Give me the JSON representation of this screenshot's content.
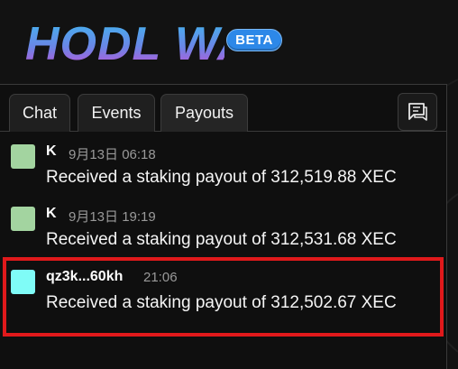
{
  "app": {
    "title": "HODL WARS",
    "badge": "BETA",
    "colors": {
      "accent": "#2d88e8",
      "logo_top": "#3fb8f0",
      "logo_bottom": "#c64fd6",
      "highlight": "#e0191b"
    }
  },
  "tabs": [
    {
      "label": "Chat",
      "active": false
    },
    {
      "label": "Events",
      "active": false
    },
    {
      "label": "Payouts",
      "active": true
    }
  ],
  "chat_icon": "chat-bubble-icon",
  "messages": [
    {
      "user": "K",
      "time": "9月13日 06:18",
      "text": "Received a staking payout of 312,519.88 XEC",
      "avatar_color": "#a3d4a0"
    },
    {
      "user": "K",
      "time": "9月13日 19:19",
      "text": "Received a staking payout of 312,531.68 XEC",
      "avatar_color": "#a3d4a0"
    },
    {
      "user": "qz3k...60kh",
      "time": "21:06",
      "text": "Received a staking payout of 312,502.67 XEC",
      "avatar_color": "#7ffcf7",
      "highlighted": true
    }
  ]
}
